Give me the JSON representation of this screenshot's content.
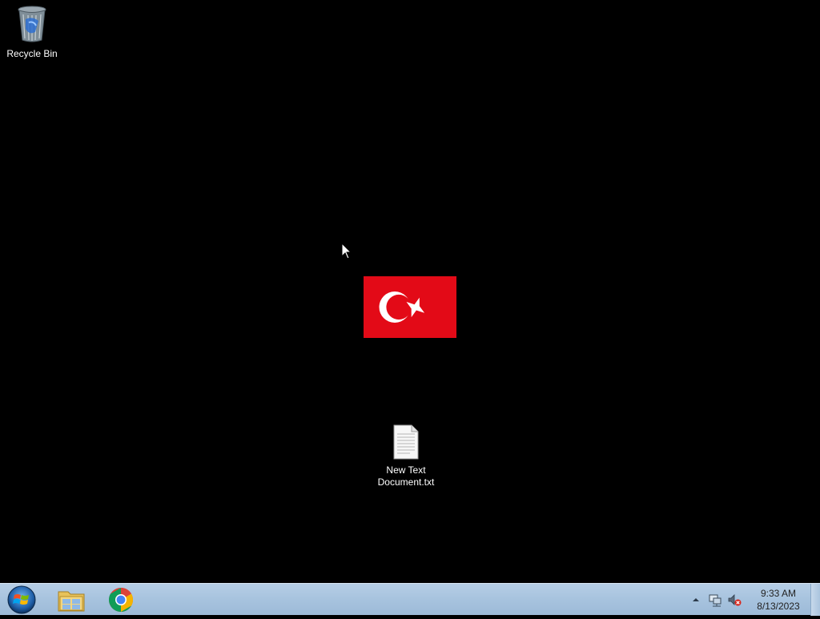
{
  "desktop": {
    "icons": [
      {
        "label": "Recycle Bin",
        "icon": "recycle-bin-icon"
      },
      {
        "label": "New Text Document.txt",
        "icon": "text-document-icon"
      }
    ],
    "wallpaper": {
      "image": "turkish-flag",
      "flag_red": "#e30a17"
    }
  },
  "taskbar": {
    "start": {
      "icon": "windows-start-orb-icon"
    },
    "pinned": [
      {
        "name": "File Explorer",
        "icon": "folder-explorer-icon"
      },
      {
        "name": "Google Chrome",
        "icon": "chrome-icon"
      }
    ],
    "tray": {
      "show_hidden_icon": "chevron-up-icon",
      "network_icon": "network-icon",
      "volume_icon": "volume-muted-icon",
      "time": "9:33 AM",
      "date": "8/13/2023"
    },
    "colors": {
      "background": "#a9c4df"
    }
  }
}
